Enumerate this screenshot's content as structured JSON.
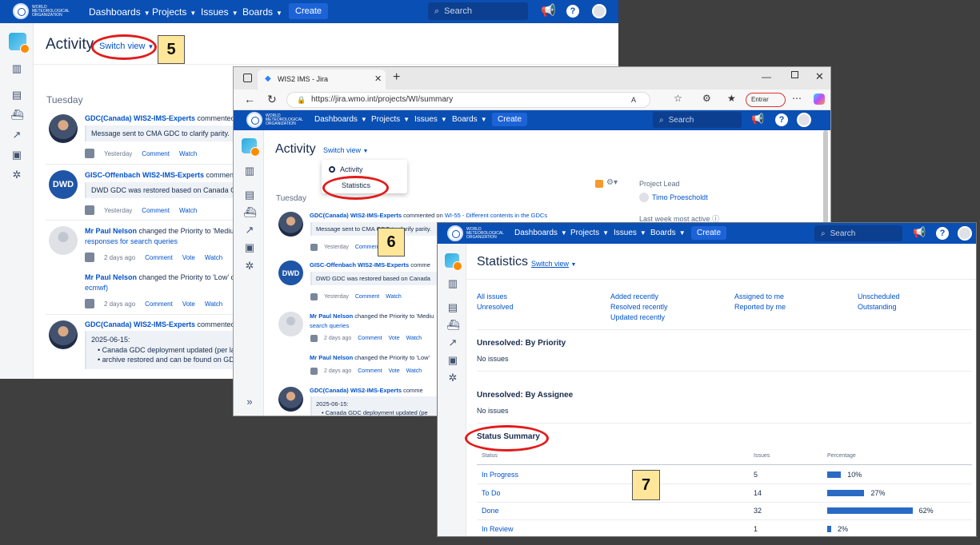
{
  "nav": {
    "logo_text": "World Meteorological Organization",
    "dashboards": "Dashboards",
    "projects": "Projects",
    "issues": "Issues",
    "boards": "Boards",
    "create": "Create",
    "search_placeholder": "Search",
    "help": "?"
  },
  "activity": {
    "title": "Activity",
    "switch_view": "Switch view",
    "day": "Tuesday",
    "entries": [
      {
        "actor": "GDC(Canada) WIS2-IMS-Experts",
        "action": "commented",
        "comment": "Message sent to CMA GDC to clarify parity.",
        "when": "Yesterday"
      },
      {
        "actor": "GISC-Offenbach WIS2-IMS-Experts",
        "action": "comment",
        "comment": "DWD GDC was restored based on Canada G",
        "when": "Yesterday"
      },
      {
        "actor": "Mr Paul Nelson",
        "action": "changed the Priority to 'Medium'",
        "link": "responses for search queries",
        "when": "2 days ago"
      },
      {
        "actor": "Mr Paul Nelson",
        "action": "changed the Priority to 'Low' o",
        "link": "ecmwf)",
        "when": "2 days ago"
      },
      {
        "actor": "GDC(Canada) WIS2-IMS-Experts",
        "action": "commented",
        "date": "2025-06-15:",
        "bullet1": "Canada GDC deployment updated (per la",
        "bullet2": "archive restored and can be found on GD"
      }
    ],
    "meta": {
      "comment": "Comment",
      "watch": "Watch",
      "vote": "Vote"
    },
    "avatar_dwd": "DWD"
  },
  "browser": {
    "tab_title": "WIS2 IMS - Jira",
    "url": "https://jira.wmo.int/projects/WI/summary",
    "entrar": "Entrar",
    "dropdown": {
      "activity": "Activity",
      "statistics": "Statistics"
    },
    "project_lead_label": "Project Lead",
    "project_lead_name": "Timo Proescholdt",
    "last_week": "Last week most active",
    "entries": [
      {
        "actor": "GDC(Canada) WIS2-IMS-Experts",
        "action": "commented on",
        "issue": "WI-55 - Different contents in the GDCs",
        "comment": "Message sent to CMA GDC to clarify parity.",
        "when": "Yesterday"
      },
      {
        "actor": "GISC-Offenbach WIS2-IMS-Experts",
        "action": "comme",
        "comment": "DWD GDC was restored based on Canada",
        "when": "Yesterday"
      },
      {
        "actor": "Mr Paul Nelson",
        "action": "changed the Priority to 'Mediu",
        "link": "search queries",
        "when": "2 days ago"
      },
      {
        "actor": "Mr Paul Nelson",
        "action": "changed the Priority to 'Low'",
        "when": "2 days ago"
      },
      {
        "actor": "GDC(Canada) WIS2-IMS-Experts",
        "action": "comme",
        "date": "2025-06-15:",
        "bullet1": "Canada GDC deployment updated (pe"
      }
    ]
  },
  "stats": {
    "title": "Statistics",
    "switch_view": "Switch view",
    "filters": {
      "all_issues": "All issues",
      "unresolved": "Unresolved",
      "added_recently": "Added recently",
      "resolved_recently": "Resolved recently",
      "updated_recently": "Updated recently",
      "assigned_to_me": "Assigned to me",
      "reported_by_me": "Reported by me",
      "unscheduled": "Unscheduled",
      "outstanding": "Outstanding"
    },
    "by_priority_heading": "Unresolved: By Priority",
    "by_priority_value": "No issues",
    "by_assignee_heading": "Unresolved: By Assignee",
    "by_assignee_value": "No issues",
    "summary_heading": "Status Summary",
    "columns": {
      "status": "Status",
      "issues": "Issues",
      "percentage": "Percentage"
    },
    "rows": [
      {
        "status": "In Progress",
        "issues": "5",
        "percent": "10%",
        "fraction": 0.1
      },
      {
        "status": "To Do",
        "issues": "14",
        "percent": "27%",
        "fraction": 0.27
      },
      {
        "status": "Done",
        "issues": "32",
        "percent": "62%",
        "fraction": 0.62
      },
      {
        "status": "In Review",
        "issues": "1",
        "percent": "2%",
        "fraction": 0.02
      }
    ]
  },
  "callouts": {
    "five": "5",
    "six": "6",
    "seven": "7"
  },
  "colors": {
    "nav_blue": "#0a4fb4",
    "annotation_red": "#e21b1b",
    "callout_yellow": "#ffe699",
    "bar_blue": "#2a6ac4"
  }
}
